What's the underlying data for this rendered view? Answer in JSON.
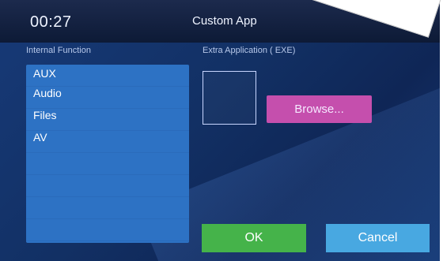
{
  "header": {
    "time": "00:27",
    "title": "Custom App"
  },
  "left_panel": {
    "label": "Internal Function",
    "items": [
      {
        "label": "AUX"
      },
      {
        "label": "Audio"
      },
      {
        "label": "Files"
      },
      {
        "label": "AV"
      }
    ]
  },
  "right_panel": {
    "label": "Extra Application ( EXE)",
    "browse_label": "Browse..."
  },
  "footer": {
    "ok_label": "OK",
    "cancel_label": "Cancel"
  },
  "colors": {
    "browse": "#c54fad",
    "ok": "#45b34a",
    "cancel": "#48a8e1",
    "list": "#2d72c4"
  }
}
